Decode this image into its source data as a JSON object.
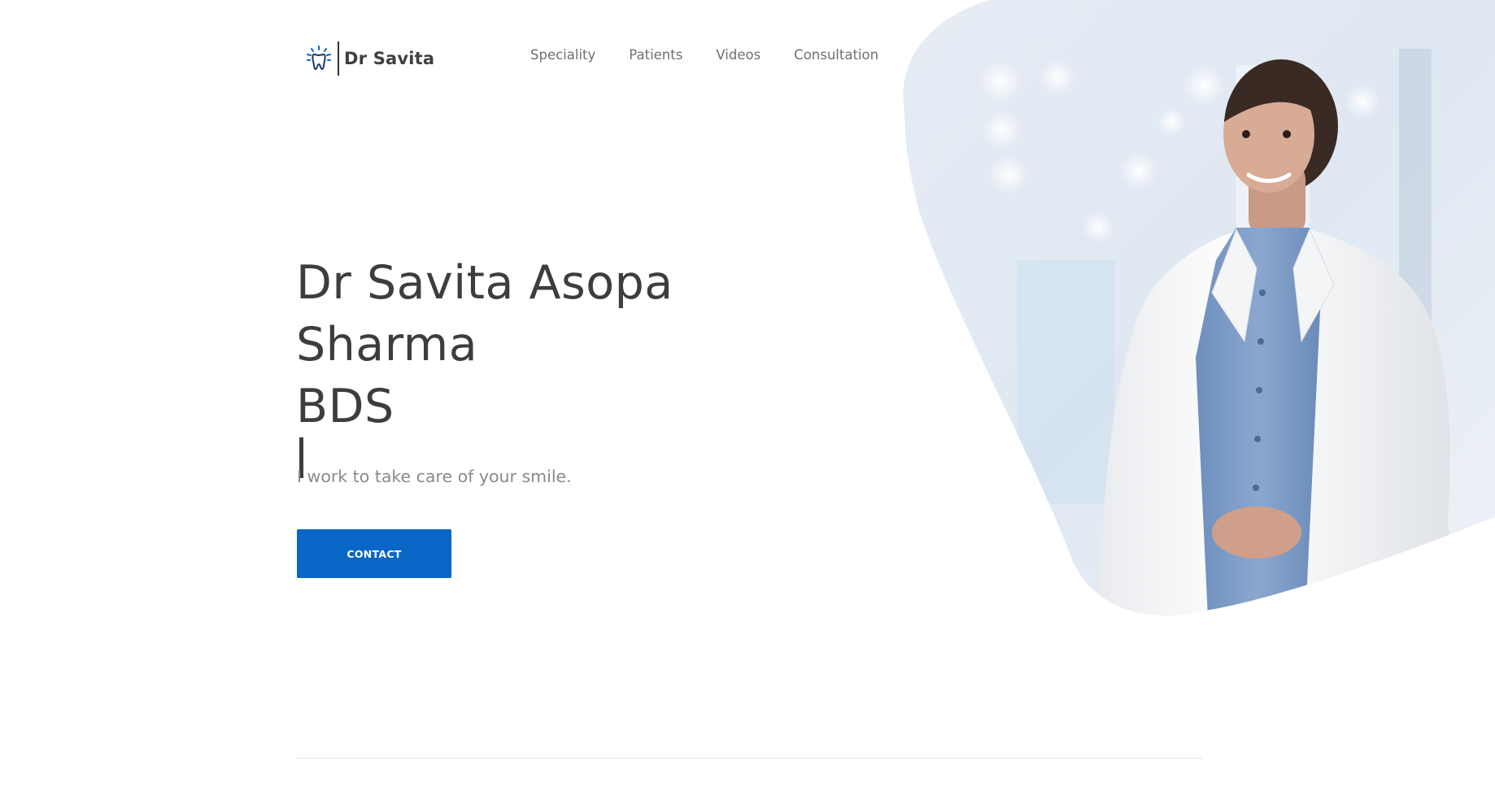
{
  "brand": {
    "name": "Dr Savita",
    "icon": "tooth-icon",
    "accent_color": "#0866c6"
  },
  "nav": {
    "items": [
      {
        "label": "Speciality"
      },
      {
        "label": "Patients"
      },
      {
        "label": "Videos"
      },
      {
        "label": "Consultation"
      }
    ]
  },
  "hero": {
    "title_line1": "Dr Savita Asopa",
    "title_line2": "Sharma",
    "title_line3": "BDS",
    "subtitle": "I work to take care of your smile.",
    "cta_label": "CONTACT",
    "photo": "doctor-portrait-image"
  }
}
